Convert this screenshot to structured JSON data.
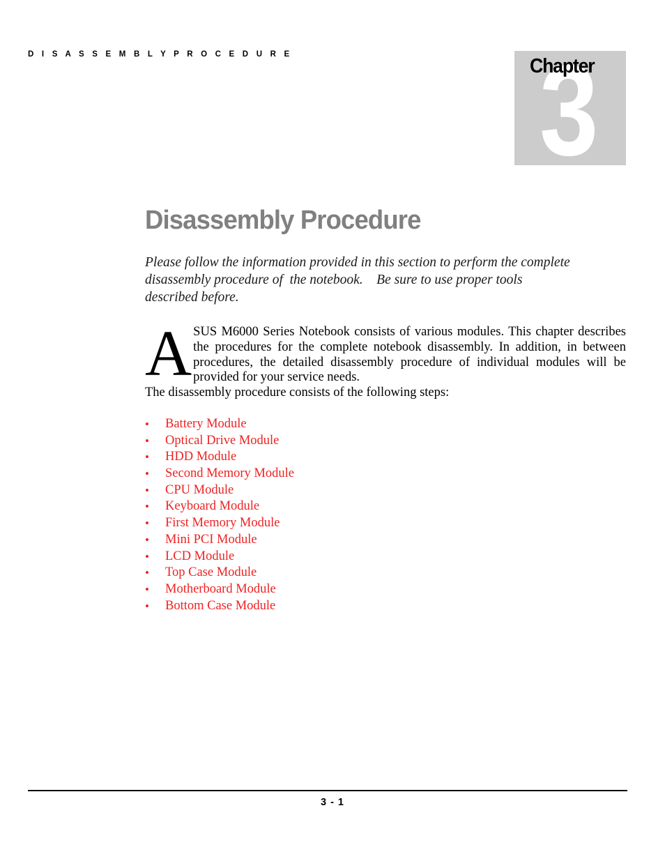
{
  "page": {
    "running_header": "D I S A S S E M B L Y   P R O C E D U R E",
    "footer_page_number": "3 - 1"
  },
  "chapter_badge": {
    "label": "Chapter",
    "number": "3",
    "background_color": "#cccccc",
    "number_color": "#ffffff",
    "label_color": "#000000"
  },
  "title": {
    "text": "Disassembly Procedure",
    "color": "#808080"
  },
  "lead_paragraph": {
    "lines": [
      "Please follow the information provided in this section to perform the complete",
      "disassembly procedure of  the notebook.    Be sure to use proper tools",
      "described before."
    ],
    "full_text": "Please follow the information provided in this section to perform the complete disassembly procedure of  the notebook.    Be sure to use proper tools described before."
  },
  "body": {
    "dropcap": "A",
    "text": "SUS M6000 Series Notebook consists of various modules. This chapter describes the procedures for the complete notebook disassembly.    In addition, in between procedures, the detailed disassembly procedure of individual modules will be provided for your service needs.",
    "followup": "The disassembly procedure consists of the following steps:"
  },
  "module_list": {
    "bullet_glyph": "•",
    "color": "#ee2222",
    "items": [
      {
        "label": "Battery Module"
      },
      {
        "label": "Optical Drive Module"
      },
      {
        "label": "HDD Module"
      },
      {
        "label": "Second Memory Module"
      },
      {
        "label": "CPU Module"
      },
      {
        "label": "Keyboard Module"
      },
      {
        "label": "First Memory Module"
      },
      {
        "label": "Mini PCI Module"
      },
      {
        "label": "LCD Module"
      },
      {
        "label": "Top Case Module"
      },
      {
        "label": "Motherboard Module"
      },
      {
        "label": "Bottom Case Module"
      }
    ]
  }
}
